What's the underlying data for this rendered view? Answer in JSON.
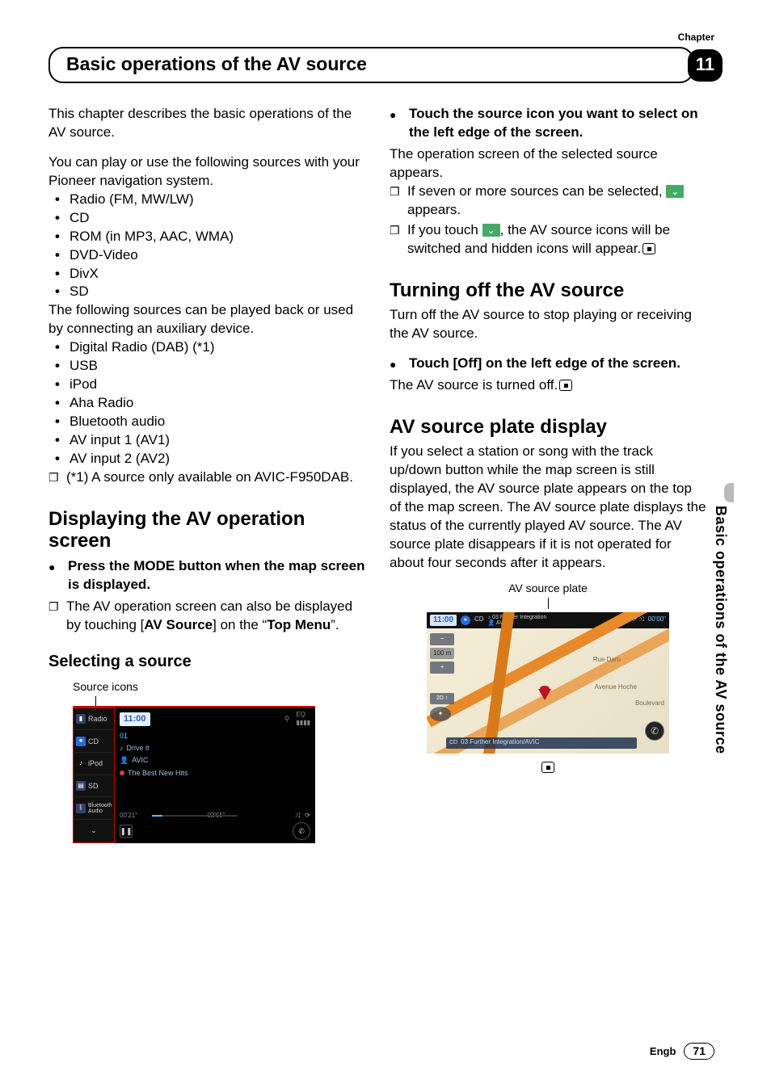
{
  "header": {
    "chapter_label": "Chapter",
    "title": "Basic operations of the AV source",
    "chapter_no": "11"
  },
  "left": {
    "intro1": "This chapter describes the basic operations of the AV source.",
    "intro2": "You can play or use the following sources with your Pioneer navigation system.",
    "sources1": [
      "Radio (FM, MW/LW)",
      "CD",
      "ROM (in MP3, AAC, WMA)",
      "DVD-Video",
      "DivX",
      "SD"
    ],
    "intro3": "The following sources can be played back or used by connecting an auxiliary device.",
    "sources2": [
      "Digital Radio (DAB) (*1)",
      "USB",
      "iPod",
      "Aha Radio",
      "Bluetooth audio",
      "AV input 1 (AV1)",
      "AV input 2 (AV2)"
    ],
    "note1": "(*1) A source only available on AVIC-F950DAB.",
    "h2a": "Displaying the AV operation screen",
    "step1": "Press the MODE button when the map screen is displayed.",
    "step1_note_a": "The AV operation screen can also be displayed by touching [",
    "step1_note_b": "AV Source",
    "step1_note_c": "] on the “",
    "step1_note_d": "Top Menu",
    "step1_note_e": "”.",
    "h3a": "Selecting a source",
    "cap1": "Source icons",
    "ss1": {
      "side": [
        "Radio",
        "CD",
        "iPod",
        "SD",
        "Bluetooth Audio"
      ],
      "time": "11:00",
      "tracknum": "01",
      "track": "Drive it",
      "artist": "AVIC",
      "album": "The Best New Hits",
      "t_cur": "00'21\"",
      "t_tot": "02'55\"",
      "eq": "EQ"
    }
  },
  "right": {
    "step2": "Touch the source icon you want to select on the left edge of the screen.",
    "step2_body": "The operation screen of the selected source appears.",
    "step2_n1a": "If seven or more sources can be selected, ",
    "step2_n1b": " appears.",
    "step2_n2a": "If you touch ",
    "step2_n2b": ", the AV source icons will be switched and hidden icons will appear.",
    "h2b": "Turning off the AV source",
    "p_off": "Turn off the AV source to stop playing or receiving the AV source.",
    "step3": "Touch [Off] on the left edge of the screen.",
    "step3_body": "The AV source is turned off.",
    "h2c": "AV source plate display",
    "p_plate": "If you select a station or song with the track up/down button while the map screen is still displayed, the AV source plate appears on the top of the map screen. The AV source plate displays the status of the currently played AV source. The AV source plate disappears if it is not operated for about four seconds after it appears.",
    "cap2": "AV source plate",
    "ss2": {
      "time": "11:00",
      "cd": "CD",
      "track_top": "03  Further Integration",
      "artist_top": "AVIC",
      "dur": "00'00\"",
      "scale": "100 m",
      "bot": "03  Further Integration/AVIC",
      "road1": "Rue Daru",
      "road2": "Avenue Hoche",
      "road3": "Boulevard"
    }
  },
  "side_tab": "Basic operations of the AV source",
  "footer": {
    "lang": "Engb",
    "page": "71"
  }
}
